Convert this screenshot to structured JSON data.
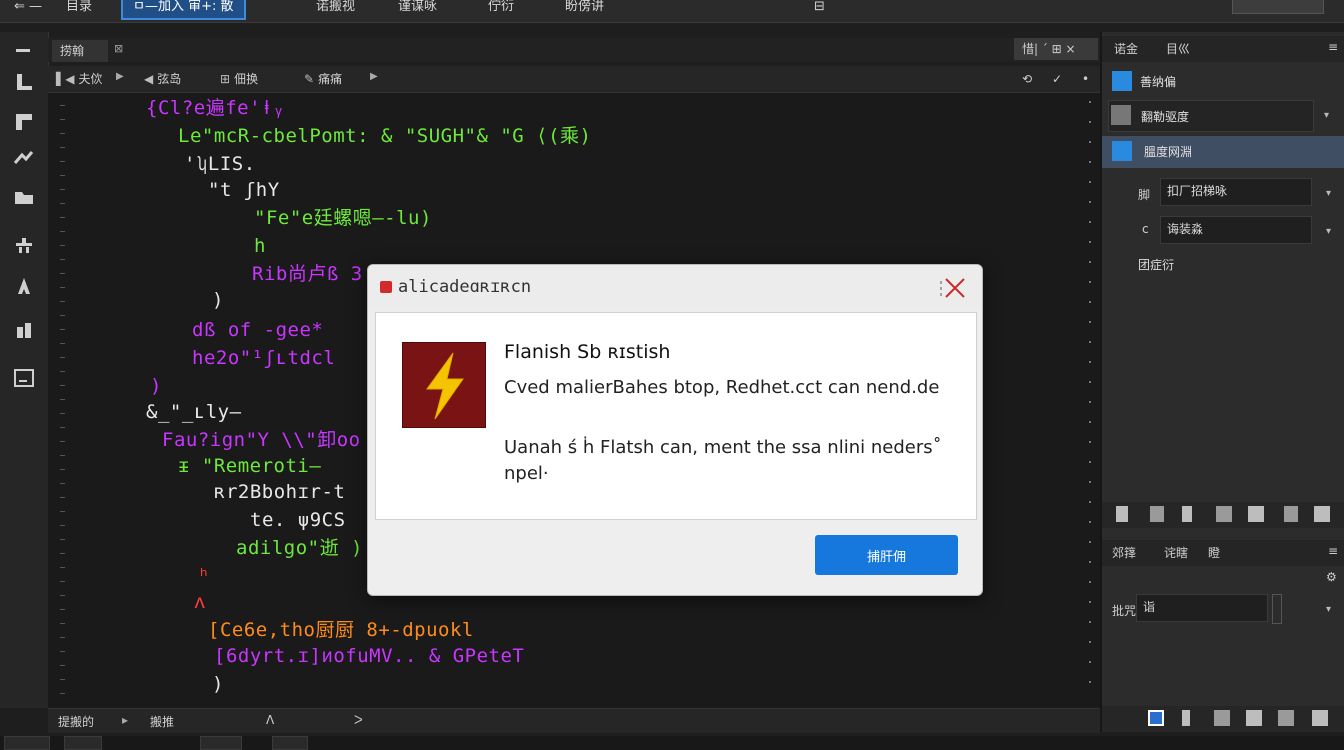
{
  "menubar": {
    "items": [
      "⇐ —",
      "目录",
      "ㅁ—加入 审+: 散",
      "诺搬视",
      "谨谋咏",
      "佇衍",
      "盼傍讲"
    ],
    "center_glyph": "⊟"
  },
  "tabs": {
    "main_label": "捞翰",
    "close_glyph": "⊠",
    "doc_controls": "惜| ˊ ⊞ ×"
  },
  "subbar": {
    "items": [
      {
        "glyph": "▌◀",
        "label": "夫佽"
      },
      {
        "glyph": "◀",
        "label": "弦岛"
      },
      {
        "glyph": "⊞",
        "label": "佃换"
      },
      {
        "glyph": "✎",
        "label": "痛痛"
      }
    ],
    "right_icons": [
      "⟲",
      "✓",
      "•"
    ]
  },
  "code_lines": [
    {
      "text": "{Cl?e遍fe'ⱡᵧ",
      "color": "#c836ff"
    },
    {
      "text": "Le\"mcR-cbelPomt: & \"SUGH\"& \"G ⟨(乘)",
      "color": "#6ee83a"
    },
    {
      "text": "'ʮLIS.",
      "color": "#e8e8e8"
    },
    {
      "text": "\"t ʃhY",
      "color": "#e8e8e8"
    },
    {
      "text": "\"Fe\"e廷螺嗯—-lu)",
      "color": "#6ee83a"
    },
    {
      "text": "h",
      "color": "#6ee83a"
    },
    {
      "text": "Rib尚卢ß 3",
      "color": "#c836ff"
    },
    {
      "text": ")",
      "color": "#e8e8e8"
    },
    {
      "text": "dß of -gee*",
      "color": "#c836ff"
    },
    {
      "text": "he2o\"¹ʃʟtdcl",
      "color": "#c836ff"
    },
    {
      "text": ")",
      "color": "#c836ff"
    },
    {
      "text": "&_\"_ʟly—",
      "color": "#e8e8e8"
    },
    {
      "text": "Fau?ign\"Y \\\\\"卸oo",
      "color": "#c836ff"
    },
    {
      "text": "ᵻ \"Remeroti—",
      "color": "#6ee83a"
    },
    {
      "text": "ʀr2Bbohɪr-t",
      "color": "#e8e8e8"
    },
    {
      "text": "te. ψ9CS",
      "color": "#e8e8e8"
    },
    {
      "text": "adilgo\"逝 )",
      "color": "#6ee83a"
    },
    {
      "text": "ʰ",
      "color": "#ff3b3b"
    },
    {
      "text": "ᴧ",
      "color": "#ff3b3b"
    },
    {
      "text": "[Ce6e,tho厨厨 8+-dpuokl",
      "color": "#ff8c1a"
    },
    {
      "text": "[6dyrt.ɪ]ᴎofuMV.. & GPeteT",
      "color": "#c836ff"
    },
    {
      "text": ")",
      "color": "#e8e8e8"
    }
  ],
  "statusbar": {
    "left_label": "提搬的",
    "mid_label": "搬推",
    "right_glyphs": [
      "ᐱ",
      "ᐳ"
    ]
  },
  "right_panel": {
    "tabs_top": [
      "诺金",
      "目巛"
    ],
    "rows": [
      {
        "label": "善纳偏",
        "icon_color": "#2a8ae0"
      },
      {
        "label": "翻勒驱度",
        "icon_color": "#777777"
      },
      {
        "label": "膃度网淵",
        "icon_color": "#2a8ae0"
      }
    ],
    "field1_prefix": "脚",
    "field1_value": "扣厂招梯咏",
    "field2_prefix": "c",
    "field2_value": "诲装淼",
    "section_label": "团症衍",
    "tabs_bottom": [
      "郊箨",
      "诧瞎",
      "瞪"
    ],
    "input_label": "批咒",
    "input_value": "诣"
  },
  "dialog": {
    "title": "alicadeɑʀɪʀcn",
    "heading": "Flanish Sb ʀɪstish",
    "body1": "Cved malierBahes btop, Redhet.cct can nend.de",
    "body2": "Uanah ś ḣ Flatsh can, ment the ssa nlini neders˚ npel·",
    "button_label": "捕肝佣"
  }
}
